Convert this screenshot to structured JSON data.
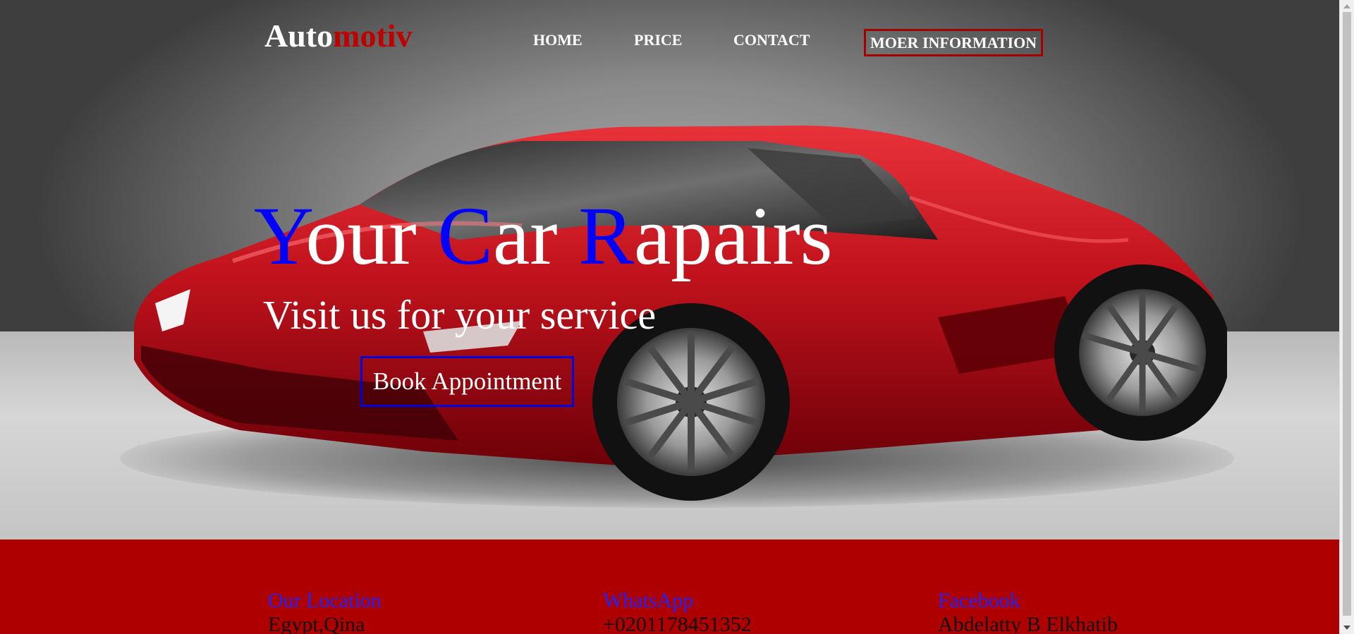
{
  "header": {
    "logo_main": "Auto",
    "logo_accent": "motiv",
    "nav": {
      "home": "HOME",
      "price": "PRICE",
      "contact": "CONTACT",
      "more": "MOER INFORMATION"
    }
  },
  "hero": {
    "headline": {
      "w1_cap": "Y",
      "w1_rest": "our",
      "w2_cap": "C",
      "w2_rest": "ar",
      "w3_cap": "R",
      "w3_rest": "apairs"
    },
    "subline": "Visit us for your service",
    "button": "Book Appointment"
  },
  "footer": {
    "location": {
      "title": "Our Location",
      "value": "Egypt,Qina"
    },
    "whatsapp": {
      "title": "WhatsApp",
      "value": "+0201178451352"
    },
    "facebook": {
      "title": "Facebook",
      "value": "Abdelatty B Elkhatib"
    }
  },
  "colors": {
    "brand_red": "#ae0000",
    "logo_accent": "#c00000",
    "headline_caps": "#0000ff",
    "footer_titles": "#2222ff",
    "nav_more_border": "#a40000",
    "button_border": "#0000e0"
  },
  "icons": [
    "car-image"
  ]
}
